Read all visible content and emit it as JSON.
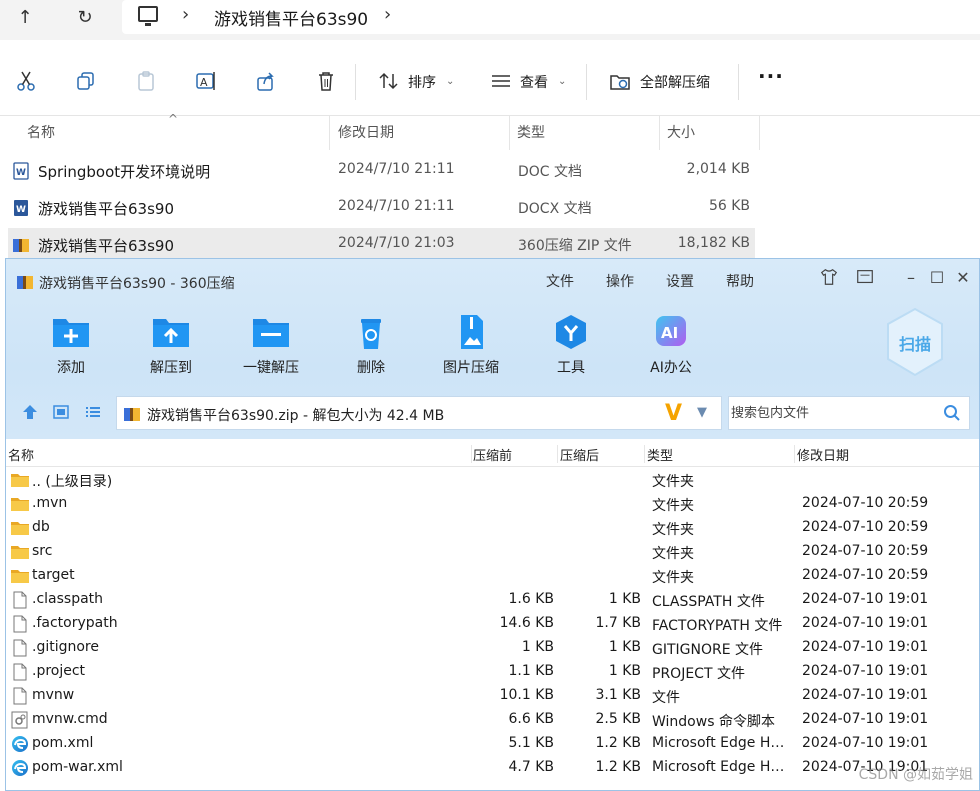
{
  "explorer": {
    "breadcrumb": "游戏销售平台63s90",
    "toolbar": {
      "sort_label": "排序",
      "view_label": "查看",
      "extract_all_label": "全部解压缩",
      "more_label": "···"
    },
    "columns": {
      "name": "名称",
      "modified": "修改日期",
      "type": "类型",
      "size": "大小"
    },
    "files": [
      {
        "name": "Springboot开发环境说明",
        "modified": "2024/7/10 21:11",
        "type": "DOC 文档",
        "size": "2,014 KB",
        "icon": "word-doc-icon"
      },
      {
        "name": "游戏销售平台63s90",
        "modified": "2024/7/10 21:11",
        "type": "DOCX 文档",
        "size": "56 KB",
        "icon": "word-docx-icon"
      },
      {
        "name": "游戏销售平台63s90",
        "modified": "2024/7/10 21:03",
        "type": "360压缩 ZIP 文件",
        "size": "18,182 KB",
        "icon": "zip-archive-icon"
      }
    ]
  },
  "zipwin": {
    "title": "游戏销售平台63s90 - 360压缩",
    "menu": [
      "文件",
      "操作",
      "设置",
      "帮助"
    ],
    "buttons": [
      {
        "label": "添加",
        "icon": "add-folder-icon"
      },
      {
        "label": "解压到",
        "icon": "extract-to-icon"
      },
      {
        "label": "一键解压",
        "icon": "one-click-extract-icon"
      },
      {
        "label": "删除",
        "icon": "recycle-bin-icon"
      },
      {
        "label": "图片压缩",
        "icon": "image-compress-icon"
      },
      {
        "label": "工具",
        "icon": "tools-icon"
      },
      {
        "label": "AI办公",
        "icon": "ai-office-icon"
      }
    ],
    "scan_label": "扫描",
    "path_text": "游戏销售平台63s90.zip - 解包大小为 42.4 MB",
    "search_placeholder": "搜索包内文件",
    "columns": {
      "name": "名称",
      "before": "压缩前",
      "after": "压缩后",
      "type": "类型",
      "modified": "修改日期"
    },
    "rows": [
      {
        "name": ".. (上级目录)",
        "before": "",
        "after": "",
        "type": "文件夹",
        "modified": "",
        "icon": "folder"
      },
      {
        "name": ".mvn",
        "before": "",
        "after": "",
        "type": "文件夹",
        "modified": "2024-07-10 20:59",
        "icon": "folder"
      },
      {
        "name": "db",
        "before": "",
        "after": "",
        "type": "文件夹",
        "modified": "2024-07-10 20:59",
        "icon": "folder"
      },
      {
        "name": "src",
        "before": "",
        "after": "",
        "type": "文件夹",
        "modified": "2024-07-10 20:59",
        "icon": "folder"
      },
      {
        "name": "target",
        "before": "",
        "after": "",
        "type": "文件夹",
        "modified": "2024-07-10 20:59",
        "icon": "folder"
      },
      {
        "name": ".classpath",
        "before": "1.6 KB",
        "after": "1 KB",
        "type": "CLASSPATH 文件",
        "modified": "2024-07-10 19:01",
        "icon": "file"
      },
      {
        "name": ".factorypath",
        "before": "14.6 KB",
        "after": "1.7 KB",
        "type": "FACTORYPATH 文件",
        "modified": "2024-07-10 19:01",
        "icon": "file"
      },
      {
        "name": ".gitignore",
        "before": "1 KB",
        "after": "1 KB",
        "type": "GITIGNORE 文件",
        "modified": "2024-07-10 19:01",
        "icon": "file"
      },
      {
        "name": ".project",
        "before": "1.1 KB",
        "after": "1 KB",
        "type": "PROJECT 文件",
        "modified": "2024-07-10 19:01",
        "icon": "file"
      },
      {
        "name": "mvnw",
        "before": "10.1 KB",
        "after": "3.1 KB",
        "type": "文件",
        "modified": "2024-07-10 19:01",
        "icon": "file"
      },
      {
        "name": "mvnw.cmd",
        "before": "6.6 KB",
        "after": "2.5 KB",
        "type": "Windows 命令脚本",
        "modified": "2024-07-10 19:01",
        "icon": "cmd"
      },
      {
        "name": "pom.xml",
        "before": "5.1 KB",
        "after": "1.2 KB",
        "type": "Microsoft Edge HT...",
        "modified": "2024-07-10 19:01",
        "icon": "edge"
      },
      {
        "name": "pom-war.xml",
        "before": "4.7 KB",
        "after": "1.2 KB",
        "type": "Microsoft Edge HT...",
        "modified": "2024-07-10 19:01",
        "icon": "edge"
      }
    ]
  },
  "watermark": "CSDN @如茹学姐",
  "colors": {
    "accent": "#1e88e5",
    "folder": "#f7c948",
    "zip_top": "#d8eaf9",
    "v_logo": "#f5a300"
  }
}
